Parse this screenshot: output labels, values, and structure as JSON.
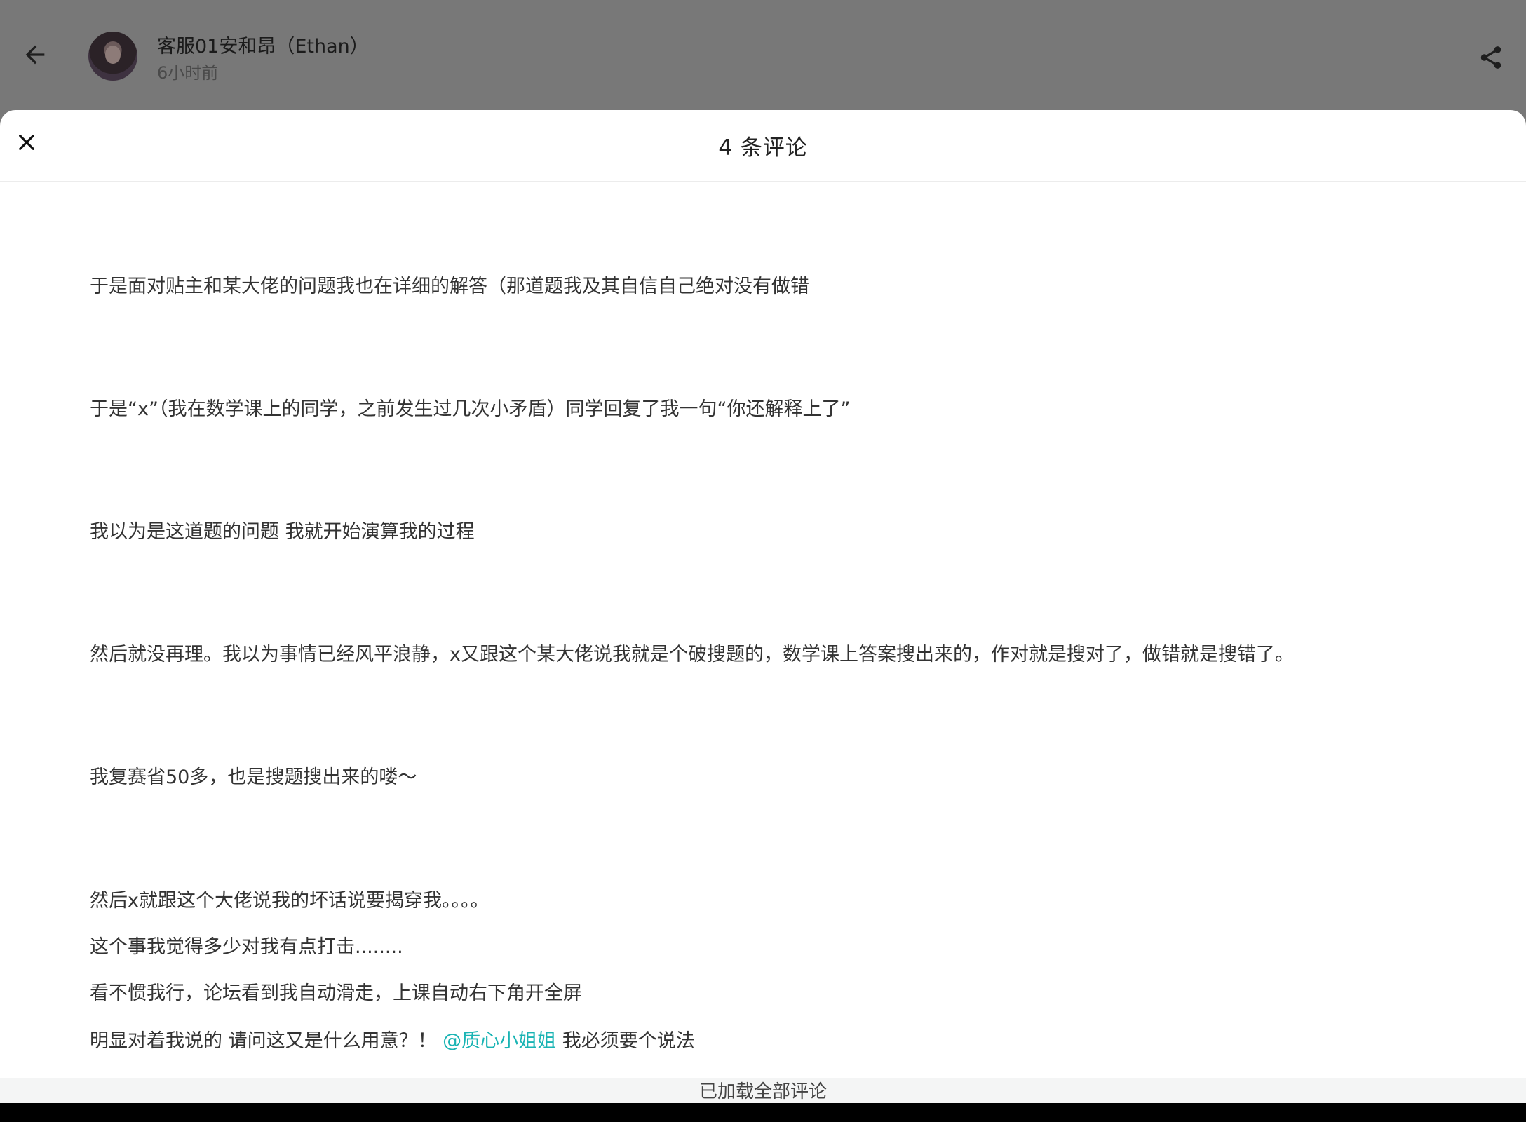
{
  "header": {
    "author_name": "客服01安和昂（Ethan）",
    "post_time": "6小时前",
    "icons": {
      "back": "arrow-left-icon",
      "share": "share-icon"
    }
  },
  "comments_sheet": {
    "title": "4 条评论",
    "close_icon": "close-icon",
    "lines": [
      "于是面对贴主和某大佬的问题我也在详细的解答（那道题我及其自信自己绝对没有做错",
      "于是“x”（我在数学课上的同学，之前发生过几次小矛盾）同学回复了我一句“你还解释上了”",
      "我以为是这道题的问题 我就开始演算我的过程",
      "然后就没再理。我以为事情已经风平浪静，x又跟这个某大佬说我就是个破搜题的，数学课上答案搜出来的，作对就是搜对了，做错就是搜错了。",
      "我复赛省50多，也是搜题搜出来的喽～",
      "然后x就跟这个大佬说我的坏话说要揭穿我。。。。",
      "这个事我觉得多少对我有点打击........",
      "看不惯我行，论坛看到我自动滑走，上课自动右下角开全屏"
    ],
    "last_line": {
      "before": "明显对着我说的 请问这又是什么用意？！ ",
      "mention": "@质心小姐姐",
      "after": " 我必须要个说法"
    },
    "mention_color": "#1ab4b4",
    "footer": "已加载全部评论"
  }
}
